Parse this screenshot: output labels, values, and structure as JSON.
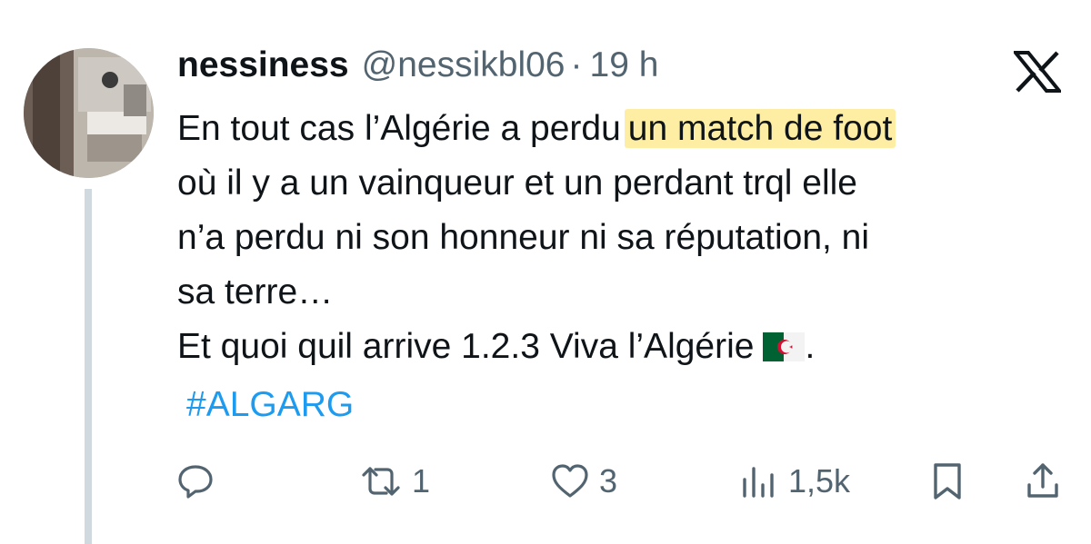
{
  "tweet": {
    "author_name": "nessiness",
    "handle": "@nessikbl06",
    "separator": "·",
    "time": "19 h",
    "text": {
      "line1_pre": "En tout cas l’Algérie a perdu",
      "line1_highlight": "un match de foot",
      "line2": "où il y a un vainqueur et un perdant trql elle",
      "line3": "n’a perdu ni son honneur ni sa réputation, ni",
      "line4": "sa terre…",
      "line5_pre": "Et quoi quil arrive 1.2.3 Viva l’Algérie",
      "line5_post": ".",
      "hashtag": "#ALGARG"
    },
    "highlight_color": "#fdeea3",
    "hashtag_color": "#1d9bf0"
  },
  "actions": {
    "reply": {
      "icon": "reply-icon",
      "count": ""
    },
    "repost": {
      "icon": "repost-icon",
      "count": "1"
    },
    "like": {
      "icon": "heart-icon",
      "count": "3"
    },
    "views": {
      "icon": "views-icon",
      "count": "1,5k"
    },
    "bookmark": {
      "icon": "bookmark-icon"
    },
    "share": {
      "icon": "share-icon"
    }
  },
  "brand": {
    "logo": "x-logo-icon"
  }
}
